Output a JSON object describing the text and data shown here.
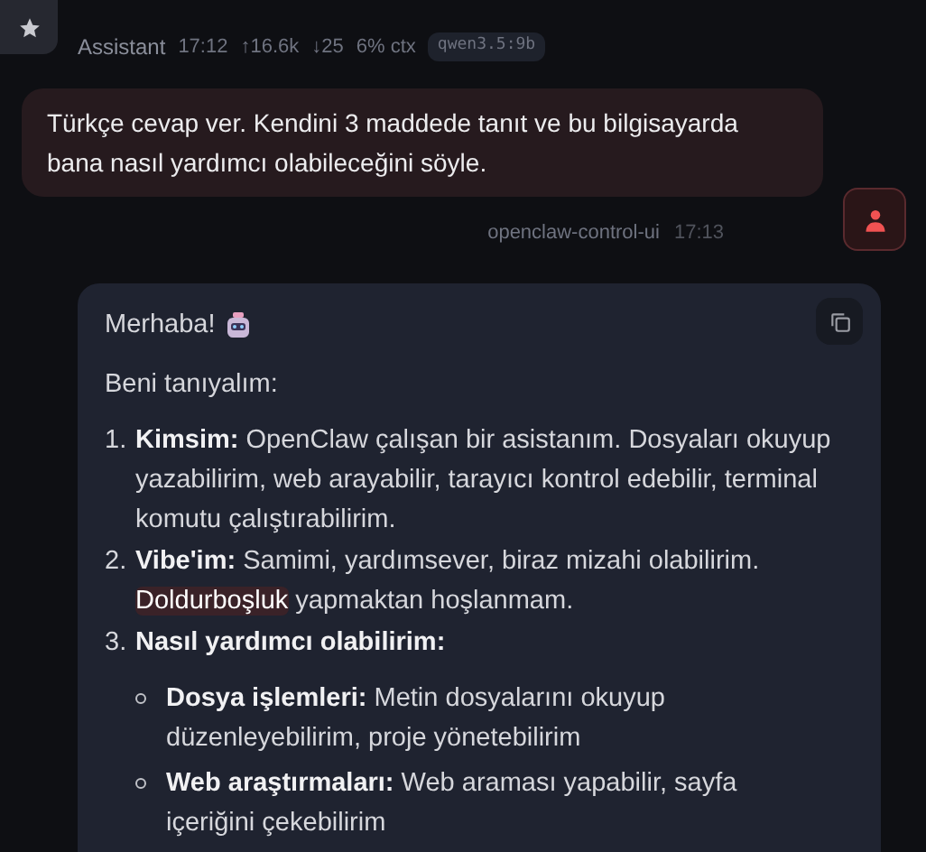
{
  "assistant_header": {
    "name": "Assistant",
    "time": "17:12",
    "tokens_in": "↑16.6k",
    "tokens_out": "↓25",
    "context": "6% ctx",
    "model": "qwen3.5:9b"
  },
  "user_message": {
    "text": "Türkçe cevap ver. Kendini 3 maddede tanıt ve bu bilgisayarda bana nasıl yardımcı olabileceğini söyle.",
    "sender": "openclaw-control-ui",
    "time": "17:13"
  },
  "assistant_message": {
    "greeting": "Merhaba!",
    "intro": "Beni tanıyalım:",
    "items": [
      {
        "number": "1.",
        "segments": [
          {
            "kind": "bold",
            "text": "Kimsim:"
          },
          {
            "kind": "text",
            "text": " OpenClaw çalışan bir asistanım. Dosyaları okuyup yazabilirim, web arayabilir, tarayıcı kontrol edebilir, terminal komutu çalıştırabilirim."
          }
        ]
      },
      {
        "number": "2.",
        "segments": [
          {
            "kind": "bold",
            "text": "Vibe'im:"
          },
          {
            "kind": "text",
            "text": " Samimi, yardımsever, biraz mizahi olabilirim. "
          },
          {
            "kind": "highlight",
            "text": "Doldurboşluk"
          },
          {
            "kind": "text",
            "text": " yapmaktan hoşlanmam."
          }
        ]
      },
      {
        "number": "3.",
        "segments": [
          {
            "kind": "bold",
            "text": "Nasıl yardımcı olabilirim:"
          }
        ],
        "children": [
          {
            "segments": [
              {
                "kind": "bold",
                "text": "Dosya işlemleri:"
              },
              {
                "kind": "text",
                "text": " Metin dosyalarını okuyup düzenleyebilirim, proje yönetebilirim"
              }
            ]
          },
          {
            "segments": [
              {
                "kind": "bold",
                "text": "Web araştırmaları:"
              },
              {
                "kind": "text",
                "text": " Web araması yapabilir, sayfa içeriğini çekebilirim"
              }
            ]
          }
        ]
      }
    ]
  }
}
